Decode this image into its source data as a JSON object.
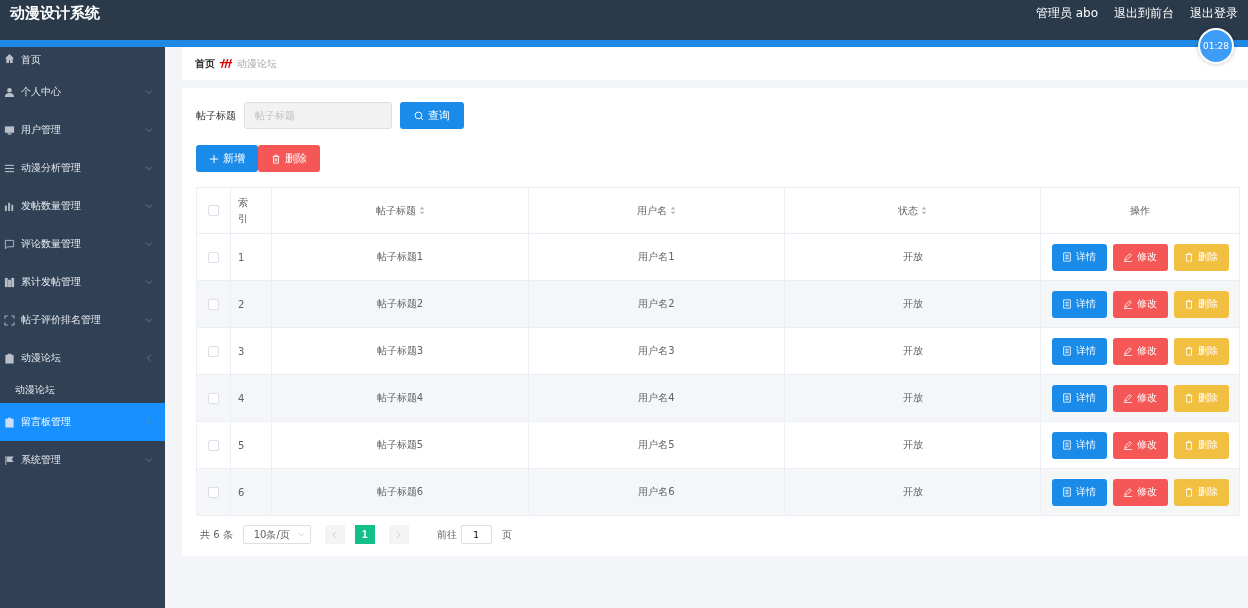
{
  "header": {
    "title": "动漫设计系统",
    "links": [
      "管理员 abo",
      "退出到前台",
      "退出登录"
    ],
    "timer": "01:28"
  },
  "sidebar": {
    "items": [
      {
        "label": "首页",
        "kind": "link",
        "selected": false
      },
      {
        "label": "个人中心",
        "kind": "submenu",
        "expanded": false,
        "selected": false
      },
      {
        "label": "用户管理",
        "kind": "submenu",
        "expanded": false,
        "selected": false
      },
      {
        "label": "动漫分析管理",
        "kind": "submenu",
        "expanded": false,
        "selected": false
      },
      {
        "label": "发帖数量管理",
        "kind": "submenu",
        "expanded": false,
        "selected": false
      },
      {
        "label": "评论数量管理",
        "kind": "submenu",
        "expanded": false,
        "selected": false
      },
      {
        "label": "累计发帖管理",
        "kind": "submenu",
        "expanded": false,
        "selected": false
      },
      {
        "label": "帖子评价排名管理",
        "kind": "submenu",
        "expanded": false,
        "selected": false
      },
      {
        "label": "动漫论坛",
        "kind": "submenu",
        "expanded": true,
        "selected": false,
        "children": [
          {
            "label": "动漫论坛",
            "selected": false
          }
        ]
      },
      {
        "label": "留言板管理",
        "kind": "submenu",
        "expanded": true,
        "selected": true
      },
      {
        "label": "系统管理",
        "kind": "submenu",
        "expanded": false,
        "selected": false
      }
    ]
  },
  "breadcrumb": [
    "首页",
    "动漫论坛"
  ],
  "search": {
    "label": "帖子标题",
    "placeholder": "帖子标题",
    "button": "查询"
  },
  "toolbar": {
    "add": "新增",
    "delete": "删除"
  },
  "table": {
    "select_all_checked": false,
    "columns": [
      {
        "label": "索引",
        "sortable": false
      },
      {
        "label": "帖子标题",
        "sortable": true
      },
      {
        "label": "用户名",
        "sortable": true
      },
      {
        "label": "状态",
        "sortable": true
      },
      {
        "label": "操作",
        "sortable": false
      }
    ],
    "rows": [
      {
        "index": "1",
        "title": "帖子标题1",
        "user": "用户名1",
        "status": "开放",
        "checked": false,
        "actions": [
          "详情",
          "修改",
          "删除"
        ]
      },
      {
        "index": "2",
        "title": "帖子标题2",
        "user": "用户名2",
        "status": "开放",
        "checked": false,
        "actions": [
          "详情",
          "修改",
          "删除"
        ]
      },
      {
        "index": "3",
        "title": "帖子标题3",
        "user": "用户名3",
        "status": "开放",
        "checked": false,
        "actions": [
          "详情",
          "修改",
          "删除"
        ]
      },
      {
        "index": "4",
        "title": "帖子标题4",
        "user": "用户名4",
        "status": "开放",
        "checked": false,
        "actions": [
          "详情",
          "修改",
          "删除"
        ]
      },
      {
        "index": "5",
        "title": "帖子标题5",
        "user": "用户名5",
        "status": "开放",
        "checked": false,
        "actions": [
          "详情",
          "修改",
          "删除"
        ]
      },
      {
        "index": "6",
        "title": "帖子标题6",
        "user": "用户名6",
        "status": "开放",
        "checked": false,
        "actions": [
          "详情",
          "修改",
          "删除"
        ]
      }
    ]
  },
  "pagination": {
    "total": "共 6 条",
    "page_size": "10条/页",
    "pages": [
      {
        "label": "1",
        "selected": true
      }
    ],
    "goto_label": "前往",
    "goto_value": "1",
    "goto_suffix": "页"
  }
}
